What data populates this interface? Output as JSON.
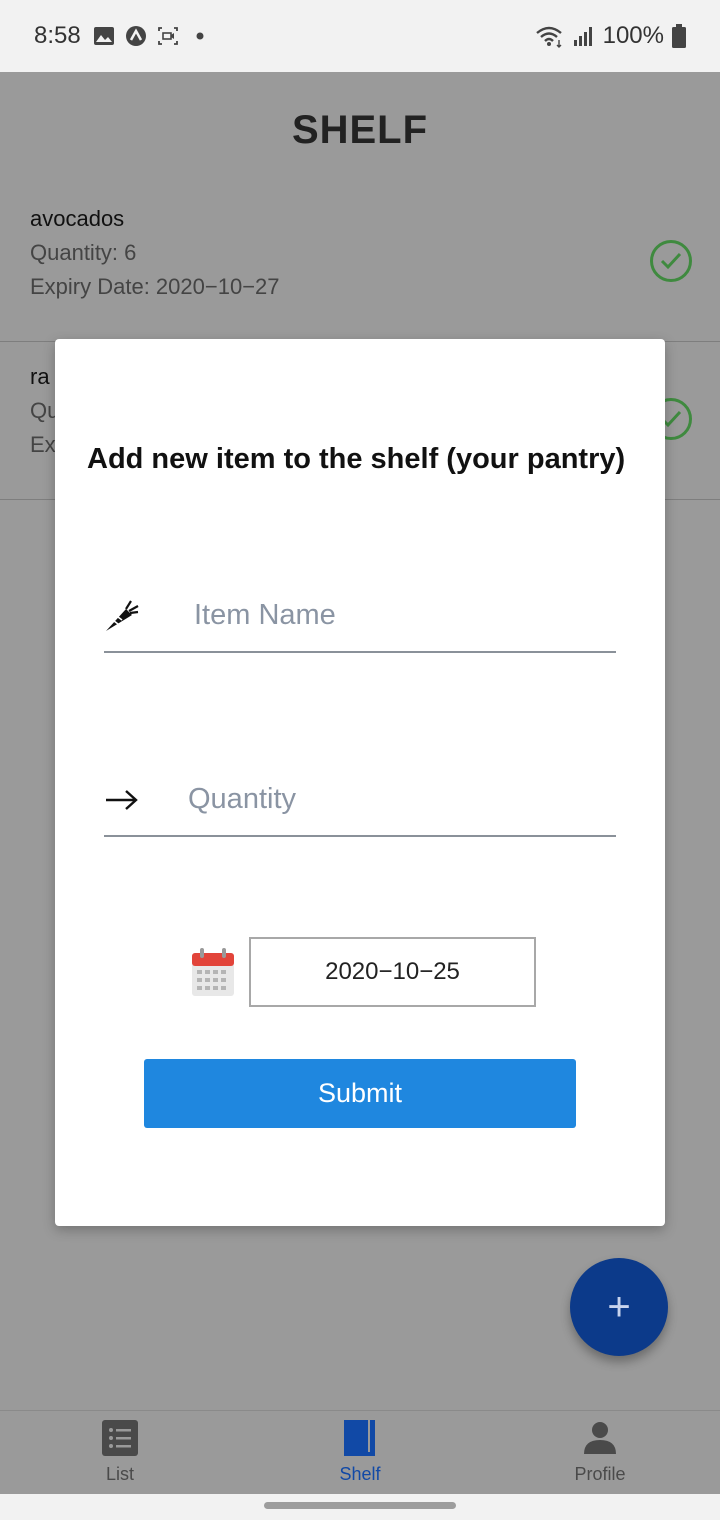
{
  "status_bar": {
    "time": "8:58",
    "battery": "100%",
    "icons": [
      "image-icon",
      "app-icon",
      "screen-record-icon",
      "dot-icon",
      "wifi-icon",
      "signal-icon",
      "battery-icon"
    ]
  },
  "header": {
    "title": "SHELF"
  },
  "shelf_items": [
    {
      "name": "avocados",
      "quantity": "Quantity: 6",
      "expiry": "Expiry Date: 2020−10−27"
    },
    {
      "name": "ra",
      "quantity": "Qu",
      "expiry": "Ex"
    }
  ],
  "modal": {
    "title": "Add new item to the shelf (your pantry)",
    "item_name_placeholder": "Item Name",
    "quantity_placeholder": "Quantity",
    "date_value": "2020−10−25",
    "submit_label": "Submit"
  },
  "fab": {
    "label": "+"
  },
  "bottom_nav": {
    "items": [
      {
        "label": "List",
        "icon": "list-icon"
      },
      {
        "label": "Shelf",
        "icon": "book-icon",
        "active": true
      },
      {
        "label": "Profile",
        "icon": "person-icon"
      }
    ]
  },
  "colors": {
    "accent": "#1f87df",
    "fab": "#0c3a8a",
    "active_nav": "#1149a6",
    "check": "#3f8a3f"
  }
}
